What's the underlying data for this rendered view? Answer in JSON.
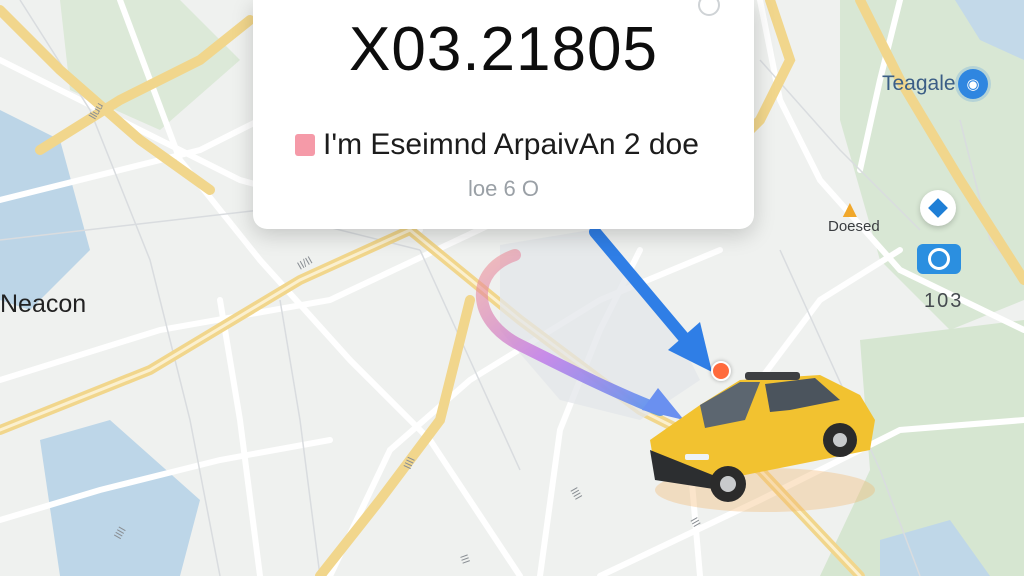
{
  "trip_card": {
    "code": "X03.21805",
    "status": "I'm Eseimnd ArpaivAn 2 doe",
    "eta": "loe 6 O"
  },
  "map_labels": {
    "left": "Neacon",
    "top_right": "Teagale",
    "middle_right": "Doesed",
    "number": "103"
  },
  "icons": {
    "route_pin": "route-marker-icon",
    "nav": "navigation-arrow-icon",
    "diamond": "directions-icon",
    "camera": "camera-icon",
    "vehicle": "taxi-icon"
  },
  "colors": {
    "route_blue": "#2f7ee6",
    "route_purple": "#b06ae6",
    "taxi_yellow": "#f2c230",
    "road_yellow": "#f2d68a",
    "water": "#b9d3e6",
    "park": "#d6e6d3"
  }
}
